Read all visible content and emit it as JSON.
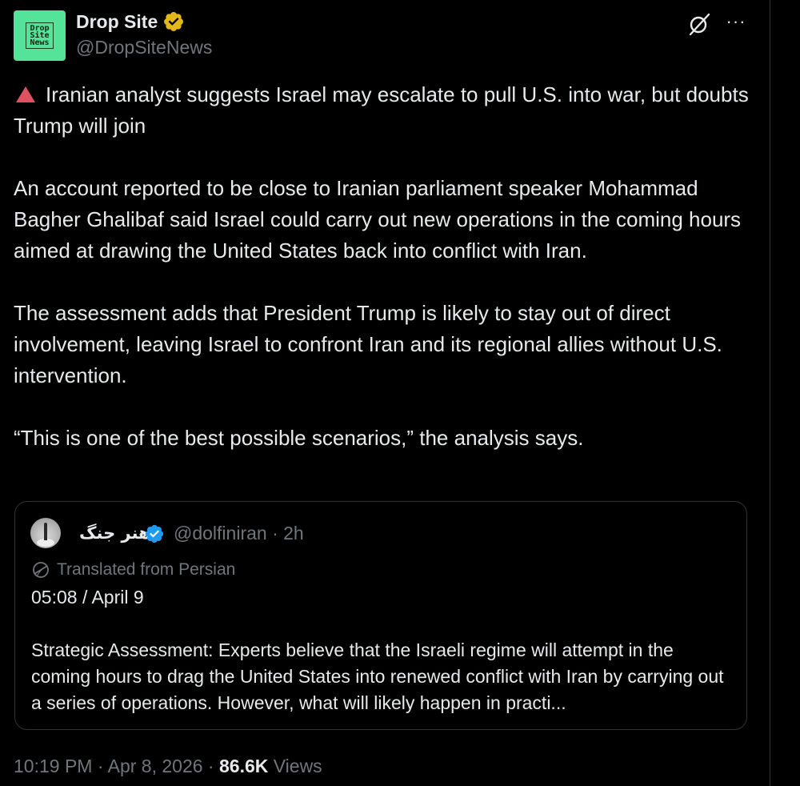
{
  "author": {
    "name": "Drop Site",
    "handle": "@DropSiteNews",
    "avatar_text": "Drop\nSite\nNews",
    "verified_color": "#e2b719"
  },
  "tweet": {
    "headline": "Iranian analyst suggests Israel may escalate to pull U.S. into war, but doubts Trump will join",
    "paragraph_1": "An account reported to be close to Iranian parliament speaker Mohammad Bagher Ghalibaf said Israel could carry out new operations in the coming hours aimed at drawing the United States back into conflict with Iran.",
    "paragraph_2": "The assessment adds that President Trump is likely to stay out of direct involvement, leaving Israel to confront Iran and its regional allies without U.S. intervention.",
    "paragraph_3": "“This is one of the best possible scenarios,” the analysis says."
  },
  "quote": {
    "name": "هنر جنگ",
    "handle_time": "@dolfiniran · 2h",
    "translated_label": "Translated from Persian",
    "line_1": "05:08 / April 9",
    "body": "Strategic Assessment: Experts believe that the Israeli regime will attempt in the coming hours to drag the United States into renewed conflict with Iran by carrying out a series of operations. However, what will likely happen in practi...",
    "verified_color": "#1d9bf0"
  },
  "meta": {
    "timestamp": "10:19 PM · Apr 8, 2026 · ",
    "views_count": "86.6K",
    "views_label": " Views"
  },
  "icons": {
    "warning": "red-triangle-icon",
    "grok": "grok-icon",
    "more": "more-icon",
    "translate": "globe-icon"
  },
  "colors": {
    "background": "#000000",
    "text": "#e7e9ea",
    "muted": "#71767b",
    "border": "#2f3336",
    "warning_red": "#e0525f"
  }
}
